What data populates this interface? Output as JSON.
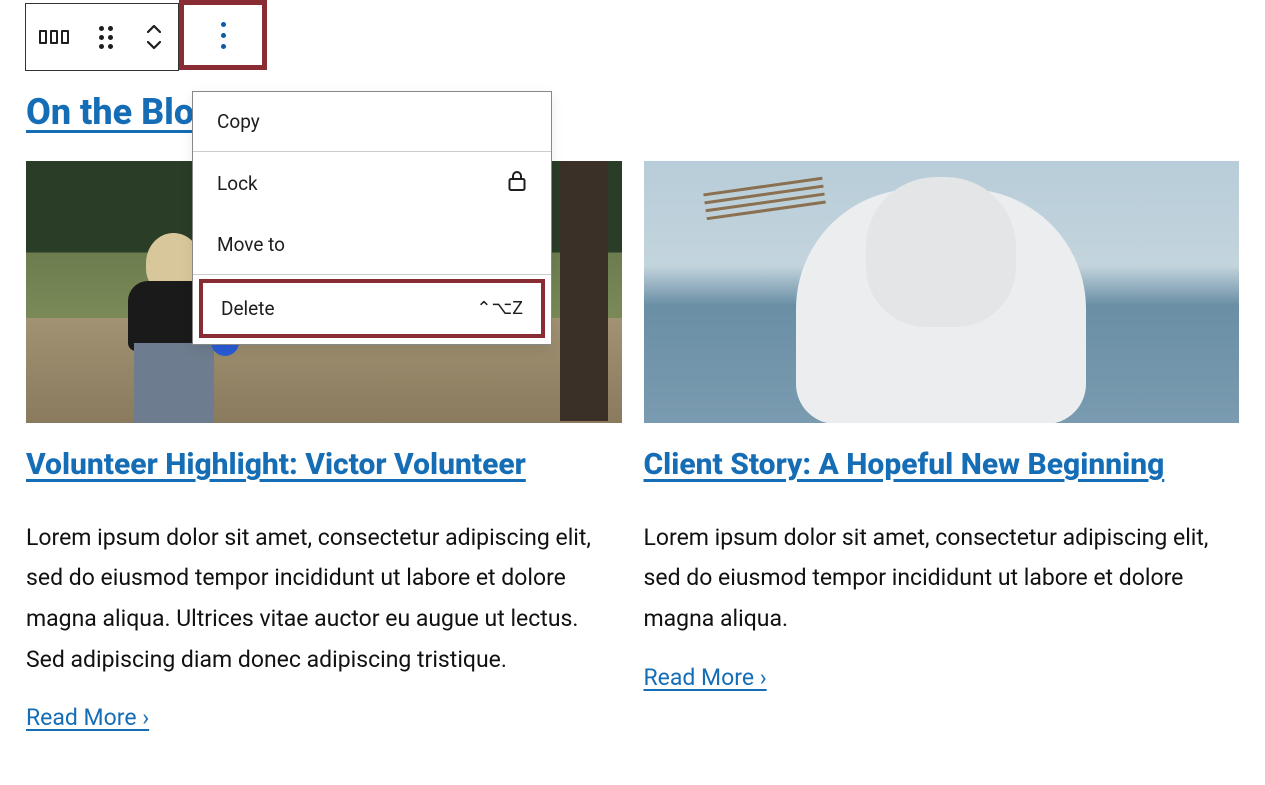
{
  "heading": "On the Blog",
  "dropdown": {
    "copy": "Copy",
    "lock": "Lock",
    "move_to": "Move to",
    "delete": "Delete",
    "delete_shortcut": "⌃⌥Z"
  },
  "icons": {
    "columns": "columns-icon",
    "drag": "drag-handle-icon",
    "move_updown": "move-vertical-icon",
    "more": "more-options-icon",
    "lock": "lock-icon"
  },
  "posts": [
    {
      "title": "Volunteer Highlight: Victor Volunteer",
      "excerpt": "Lorem ipsum dolor sit amet, consectetur adipiscing elit, sed do eiusmod tempor incididunt ut labore et dolore magna aliqua. Ultrices vitae auctor eu augue ut lectus. Sed adipiscing diam donec adipiscing tristique.",
      "read_more": "Read More ›"
    },
    {
      "title": "Client Story: A Hopeful New Beginning",
      "excerpt": "Lorem ipsum dolor sit amet, consectetur adipiscing elit, sed do eiusmod tempor incididunt ut labore et dolore magna aliqua.",
      "read_more": "Read More ›"
    }
  ]
}
